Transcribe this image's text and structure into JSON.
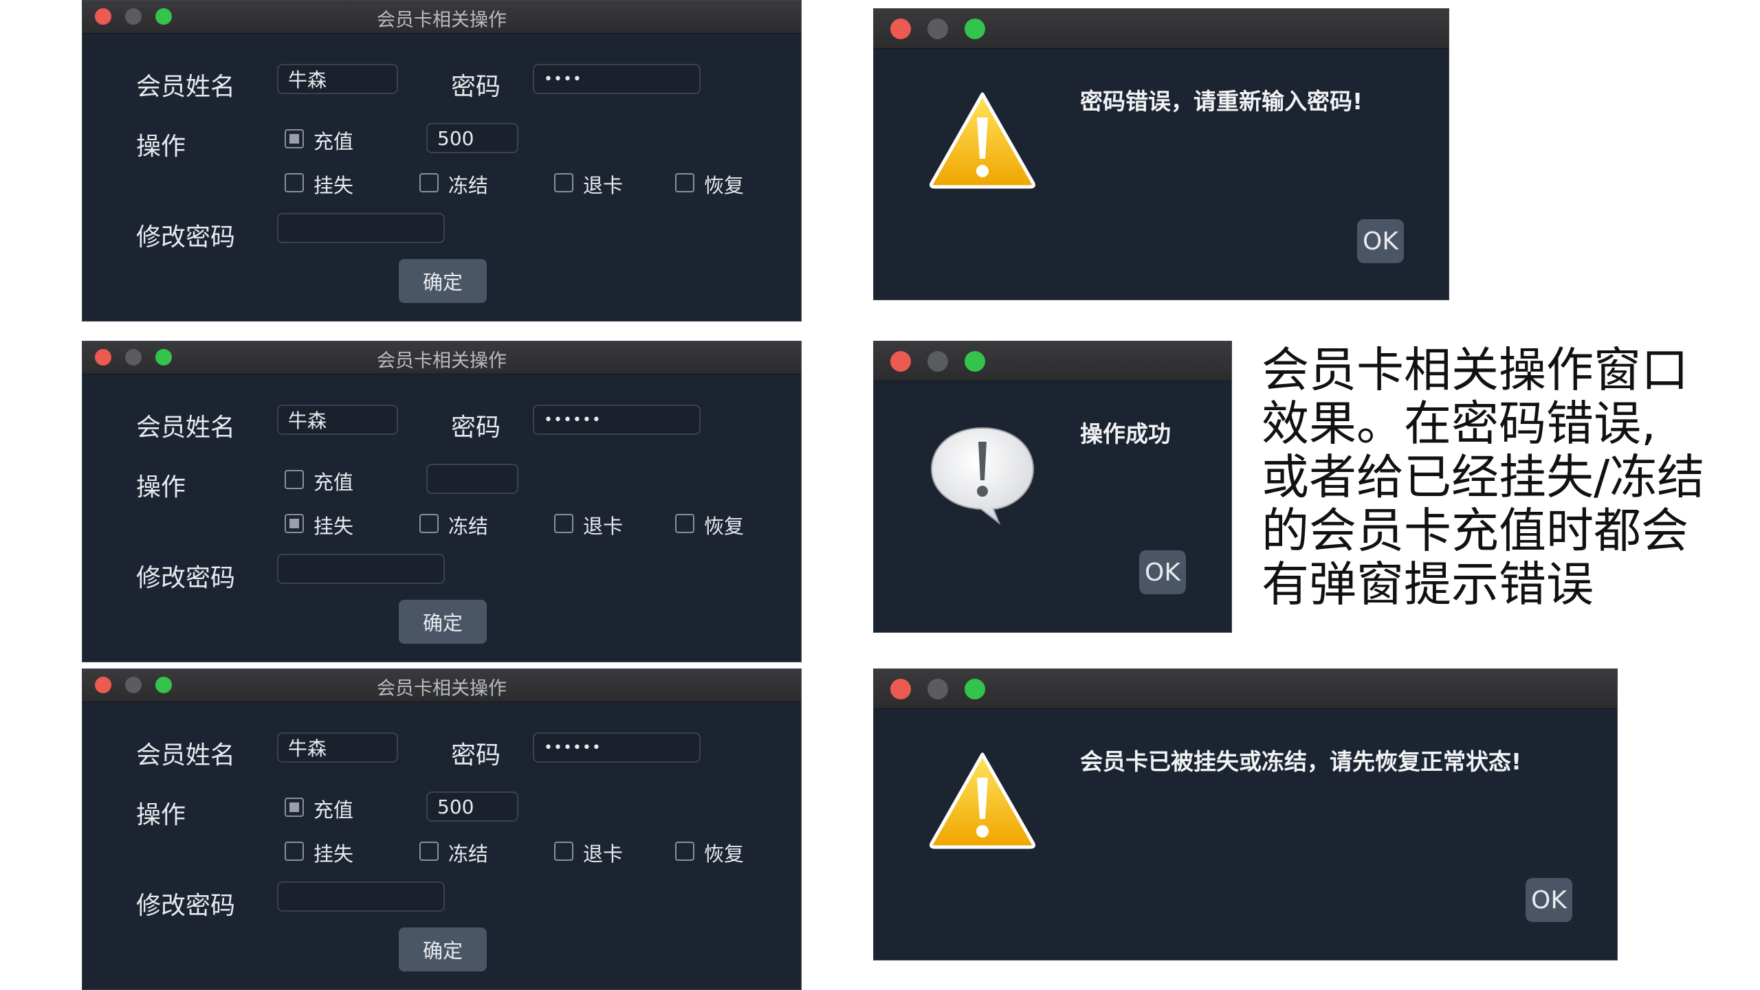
{
  "forms": [
    {
      "title": "会员卡相关操作",
      "name_label": "会员姓名",
      "name_value": "牛森",
      "password_label": "密码",
      "password_value": "••••",
      "operation_label": "操作",
      "options": [
        {
          "label": "充值",
          "checked": true
        },
        {
          "label": "挂失",
          "checked": false
        },
        {
          "label": "冻结",
          "checked": false
        },
        {
          "label": "退卡",
          "checked": false
        },
        {
          "label": "恢复",
          "checked": false
        }
      ],
      "amount_value": "500",
      "change_password_label": "修改密码",
      "change_password_value": "",
      "confirm_label": "确定"
    },
    {
      "title": "会员卡相关操作",
      "name_label": "会员姓名",
      "name_value": "牛森",
      "password_label": "密码",
      "password_value": "••••••",
      "operation_label": "操作",
      "options": [
        {
          "label": "充值",
          "checked": false
        },
        {
          "label": "挂失",
          "checked": true
        },
        {
          "label": "冻结",
          "checked": false
        },
        {
          "label": "退卡",
          "checked": false
        },
        {
          "label": "恢复",
          "checked": false
        }
      ],
      "amount_value": "",
      "change_password_label": "修改密码",
      "change_password_value": "",
      "confirm_label": "确定"
    },
    {
      "title": "会员卡相关操作",
      "name_label": "会员姓名",
      "name_value": "牛森",
      "password_label": "密码",
      "password_value": "••••••",
      "operation_label": "操作",
      "options": [
        {
          "label": "充值",
          "checked": true
        },
        {
          "label": "挂失",
          "checked": false
        },
        {
          "label": "冻结",
          "checked": false
        },
        {
          "label": "退卡",
          "checked": false
        },
        {
          "label": "恢复",
          "checked": false
        }
      ],
      "amount_value": "500",
      "change_password_label": "修改密码",
      "change_password_value": "",
      "confirm_label": "确定"
    }
  ],
  "dialogs": [
    {
      "message": "密码错误，请重新输入密码!",
      "icon": "warning-icon",
      "ok_label": "OK"
    },
    {
      "message": "操作成功",
      "icon": "info-speech-bubble-icon",
      "ok_label": "OK"
    },
    {
      "message": "会员卡已被挂失或冻结，请先恢复正常状态!",
      "icon": "warning-icon",
      "ok_label": "OK"
    }
  ],
  "caption": {
    "lines": [
      "会员卡相关操作窗口",
      "效果。在密码错误,",
      "或者给已经挂失/冻结",
      "的会员卡充值时都会",
      "有弹窗提示错误"
    ]
  },
  "colors": {
    "window_bg": "#1c2431",
    "titlebar": "#2c2c2e",
    "button": "#4a5666",
    "close": "#ed5a52",
    "zoom": "#34c34b",
    "warning": "#f2b705"
  }
}
